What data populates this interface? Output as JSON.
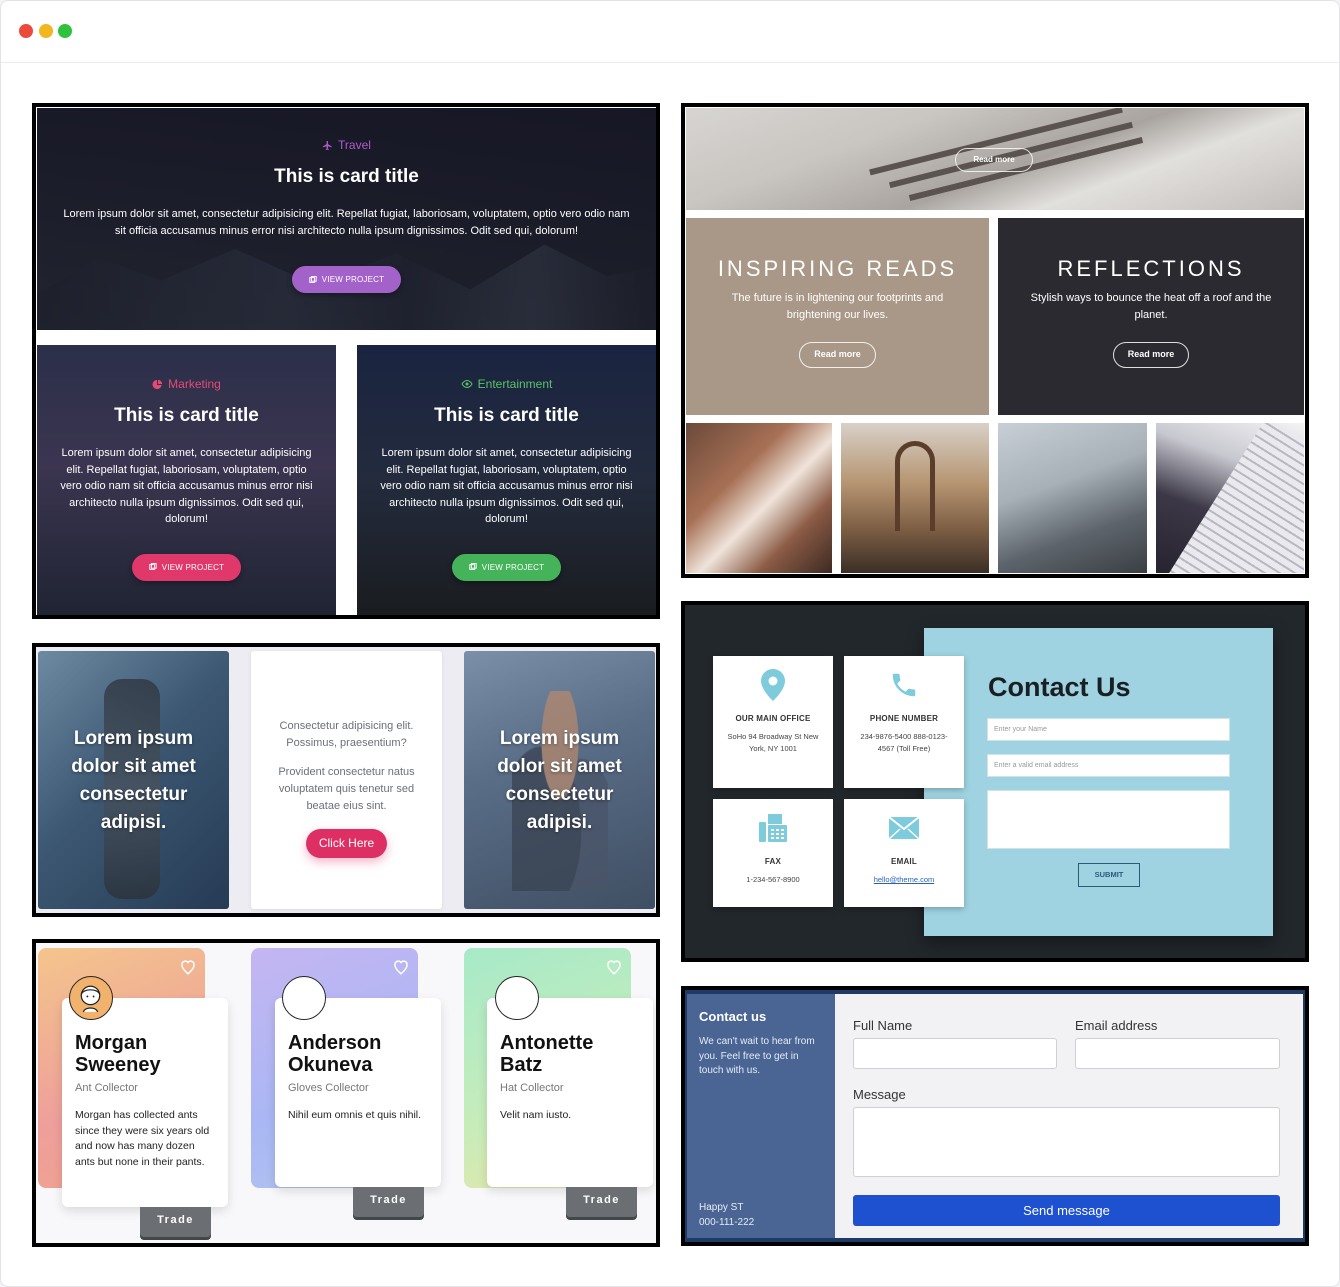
{
  "window": {
    "controls": [
      "close",
      "minimize",
      "maximize"
    ],
    "colors": {
      "close": "#ec4b3c",
      "minimize": "#f2b61f",
      "maximize": "#2fc23c"
    }
  },
  "image_cards": {
    "travel": {
      "category": "Travel",
      "title": "This is card title",
      "text": "Lorem ipsum dolor sit amet, consectetur adipisicing elit. Repellat fugiat, laboriosam, voluptatem, optio vero odio nam sit officia accusamus minus error nisi architecto nulla ipsum dignissimos. Odit sed qui, dolorum!",
      "button": "VIEW PROJECT",
      "accent": "#a362c9",
      "icon": "plane-icon"
    },
    "marketing": {
      "category": "Marketing",
      "title": "This is card title",
      "text": "Lorem ipsum dolor sit amet, consectetur adipisicing elit. Repellat fugiat, laboriosam, voluptatem, optio vero odio nam sit officia accusamus minus error nisi architecto nulla ipsum dignissimos. Odit sed qui, dolorum!",
      "button": "VIEW PROJECT",
      "accent": "#e0386a",
      "icon": "pie-chart-icon"
    },
    "entertainment": {
      "category": "Entertainment",
      "title": "This is card title",
      "text": "Lorem ipsum dolor sit amet, consectetur adipisicing elit. Repellat fugiat, laboriosam, voluptatem, optio vero odio nam sit officia accusamus minus error nisi architecto nulla ipsum dignissimos. Odit sed qui, dolorum!",
      "button": "VIEW PROJECT",
      "accent": "#44b35a",
      "icon": "eye-icon"
    }
  },
  "architecture": {
    "hero_button": "Read more",
    "inspiring": {
      "title": "INSPIRING READS",
      "subtitle": "The future is in lightening our footprints and brightening our lives.",
      "button": "Read more"
    },
    "reflections": {
      "title": "REFLECTIONS",
      "subtitle": "Stylish ways to bounce the heat off a roof and the planet.",
      "button": "Read more"
    }
  },
  "lorem_cards": {
    "left": "Lorem ipsum dolor sit amet consectetur adipisi.",
    "middle": {
      "line1": "Consectetur adipisicing elit. Possimus, praesentium?",
      "line2": "Provident consectetur natus voluptatem quis tenetur sed beatae eius sint.",
      "button": "Click Here"
    },
    "right": "Lorem ipsum dolor sit amet consectetur adipisi."
  },
  "teal_contact": {
    "title": "Contact Us",
    "office": {
      "label": "OUR MAIN OFFICE",
      "value": "SoHo 94 Broadway St New York, NY 1001"
    },
    "phone": {
      "label": "PHONE NUMBER",
      "value": "234-9876-5400 888-0123-4567 (Toll Free)"
    },
    "fax": {
      "label": "FAX",
      "value": "1-234-567-8900"
    },
    "email": {
      "label": "EMAIL",
      "value": "hello@theme.com"
    },
    "name_placeholder": "Enter your Name",
    "email_placeholder": "Enter a valid email address",
    "submit": "SUBMIT",
    "accent": "#9fd3e1"
  },
  "collectors": [
    {
      "name": "Morgan Sweeney",
      "role": "Ant Collector",
      "desc": "Morgan has collected ants since they were six years old and now has many dozen ants but none in their pants.",
      "button": "Trade"
    },
    {
      "name": "Anderson Okuneva",
      "role": "Gloves Collector",
      "desc": "Nihil eum omnis et quis nihil.",
      "button": "Trade"
    },
    {
      "name": "Antonette Batz",
      "role": "Hat Collector",
      "desc": "Velit nam iusto.",
      "button": "Trade"
    }
  ],
  "blue_contact": {
    "title": "Contact us",
    "description": "We can't wait to hear from you. Feel free to get in touch with us.",
    "address_line1": "Happy ST",
    "address_line2": "000-111-222",
    "full_name_label": "Full Name",
    "email_label": "Email address",
    "message_label": "Message",
    "button": "Send message",
    "accent": "#1d51d0"
  }
}
